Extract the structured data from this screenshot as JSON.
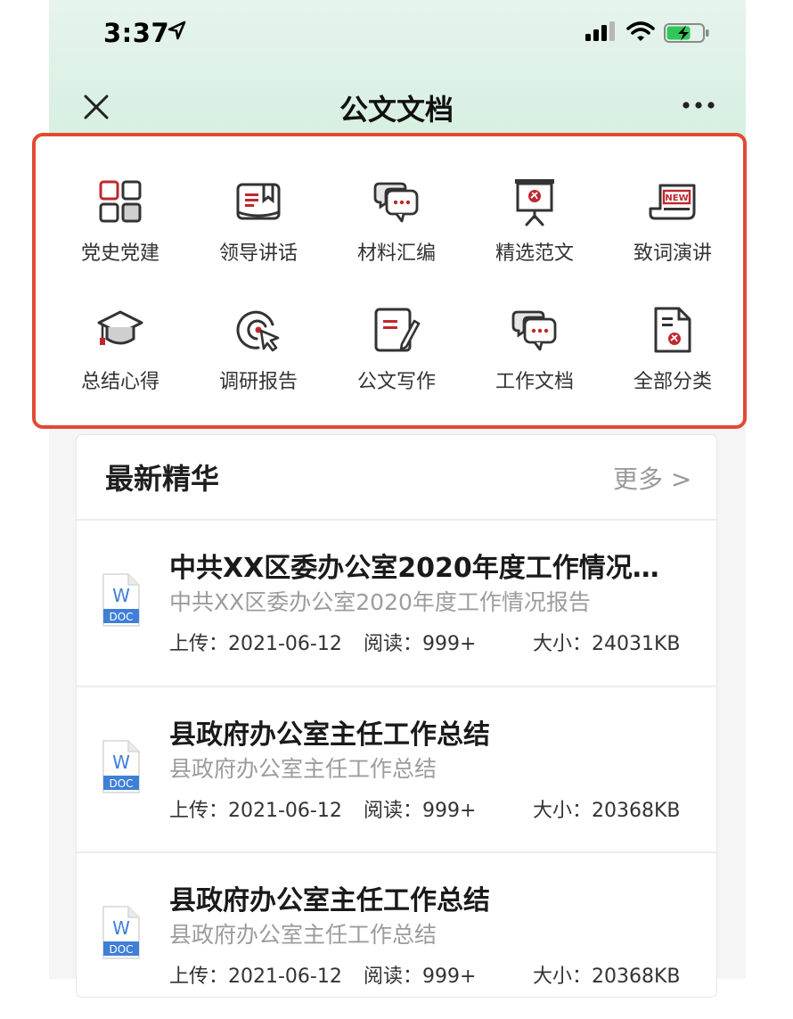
{
  "status_bar": {
    "time": "3:37"
  },
  "nav": {
    "title": "公文文档"
  },
  "categories": [
    {
      "label": "党史党建",
      "icon": "grid-apps-icon"
    },
    {
      "label": "领导讲话",
      "icon": "open-book-icon"
    },
    {
      "label": "材料汇编",
      "icon": "chat-bubbles-icon"
    },
    {
      "label": "精选范文",
      "icon": "presentation-board-icon"
    },
    {
      "label": "致词演讲",
      "icon": "newspaper-new-icon"
    },
    {
      "label": "总结心得",
      "icon": "graduation-cap-icon"
    },
    {
      "label": "调研报告",
      "icon": "target-cursor-icon"
    },
    {
      "label": "公文写作",
      "icon": "document-pen-icon"
    },
    {
      "label": "工作文档",
      "icon": "chat-bubbles-icon"
    },
    {
      "label": "全部分类",
      "icon": "file-emblem-icon"
    }
  ],
  "latest": {
    "title": "最新精华",
    "more_label": "更多 >",
    "items": [
      {
        "title": "中共XX区委办公室2020年度工作情况…",
        "subtitle": "中共XX区委办公室2020年度工作情况报告",
        "upload": "上传：2021-06-12",
        "reads": "阅读：999+",
        "size": "大小：24031KB",
        "icon_letter": "W",
        "icon_type": "DOC"
      },
      {
        "title": "县政府办公室主任工作总结",
        "subtitle": "县政府办公室主任工作总结",
        "upload": "上传：2021-06-12",
        "reads": "阅读：999+",
        "size": "大小：20368KB",
        "icon_letter": "W",
        "icon_type": "DOC"
      },
      {
        "title": "县政府办公室主任工作总结",
        "subtitle": "县政府办公室主任工作总结",
        "upload": "上传：2021-06-12",
        "reads": "阅读：999+",
        "size": "大小：20368KB",
        "icon_letter": "W",
        "icon_type": "DOC"
      }
    ]
  },
  "colors": {
    "accent_red": "#c0272d",
    "highlight_border": "#e24a32",
    "doc_blue": "#3f7fd6",
    "header_green": "#d6efe1"
  }
}
